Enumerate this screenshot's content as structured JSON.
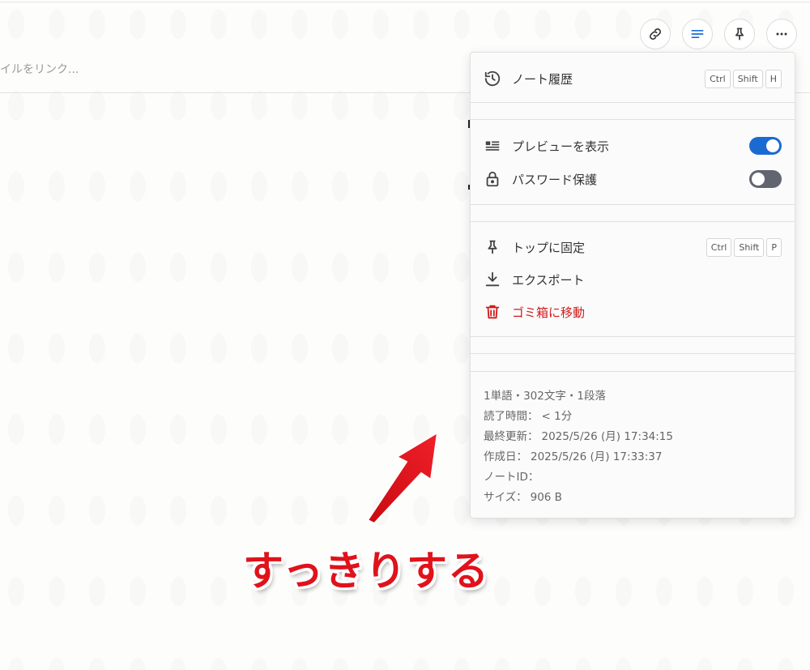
{
  "editor": {
    "placeholder_partial": "イルをリンク..."
  },
  "toolbar": {
    "buttons": [
      {
        "name": "link-icon"
      },
      {
        "name": "lines-icon",
        "color": "#1b6ad2"
      },
      {
        "name": "pin-icon"
      },
      {
        "name": "more-icon"
      }
    ]
  },
  "menu": {
    "history": {
      "label": "ノート履歴",
      "shortcut": [
        "Ctrl",
        "Shift",
        "H"
      ]
    },
    "preview": {
      "label": "プレビューを表示",
      "enabled": true
    },
    "password": {
      "label": "パスワード保護",
      "enabled": false
    },
    "pin": {
      "label": "トップに固定",
      "shortcut": [
        "Ctrl",
        "Shift",
        "P"
      ]
    },
    "export": {
      "label": "エクスポート"
    },
    "trash": {
      "label": "ゴミ箱に移動",
      "color": "#d21b1b"
    }
  },
  "info": {
    "stats": "1単語・302文字・1段落",
    "read_time_key": "読了時間：",
    "read_time_val": "< 1分",
    "updated_key": "最終更新：",
    "updated_val": "2025/5/26 (月) 17:34:15",
    "created_key": "作成日：",
    "created_val": "2025/5/26 (月) 17:33:37",
    "note_id_key": "ノートID：",
    "size_key": "サイズ：",
    "size_val": "906 B"
  },
  "annotation": {
    "caption": "すっきりする",
    "color": "#e0121b"
  }
}
